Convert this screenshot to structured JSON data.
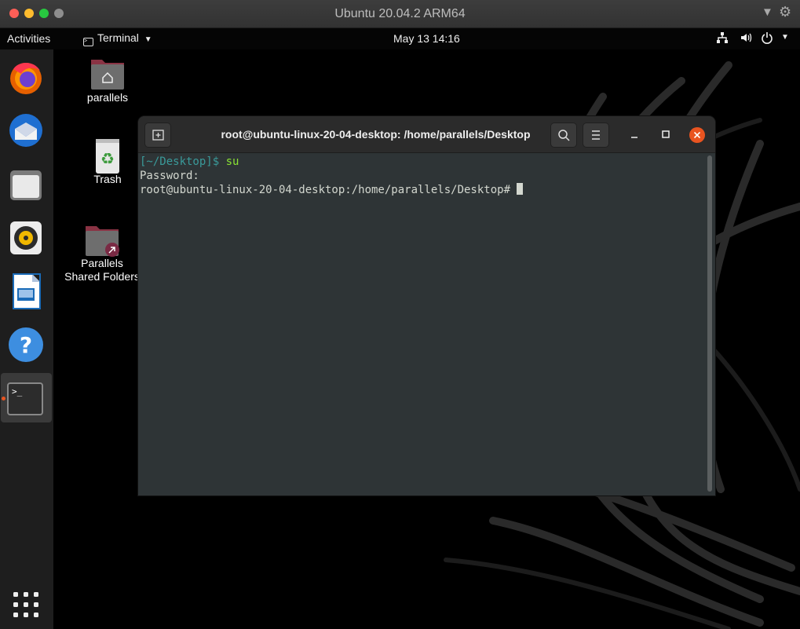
{
  "mac_window": {
    "title": "Ubuntu 20.04.2 ARM64"
  },
  "topbar": {
    "activities": "Activities",
    "app_menu": "Terminal",
    "clock": "May 13  14:16"
  },
  "dock": {
    "apps": [
      "firefox",
      "thunderbird",
      "files",
      "rhythmbox",
      "libreoffice-writer",
      "help",
      "terminal"
    ],
    "terminal_glyph": ">_"
  },
  "desktop": {
    "icons": [
      {
        "label": "parallels"
      },
      {
        "label": "Trash"
      },
      {
        "label": "Parallels Shared Folders"
      }
    ]
  },
  "terminal": {
    "title": "root@ubuntu-linux-20-04-desktop: /home/parallels/Desktop",
    "lines": {
      "prompt_path": "[~/Desktop]$",
      "command": " su",
      "password": "Password:",
      "root_prompt": "root@ubuntu-linux-20-04-desktop:/home/parallels/Desktop# "
    }
  },
  "colors": {
    "terminal_bg": "#2e3436",
    "prompt_teal": "#3a9a9a",
    "command_green": "#8ae234",
    "close_button": "#e95420"
  }
}
